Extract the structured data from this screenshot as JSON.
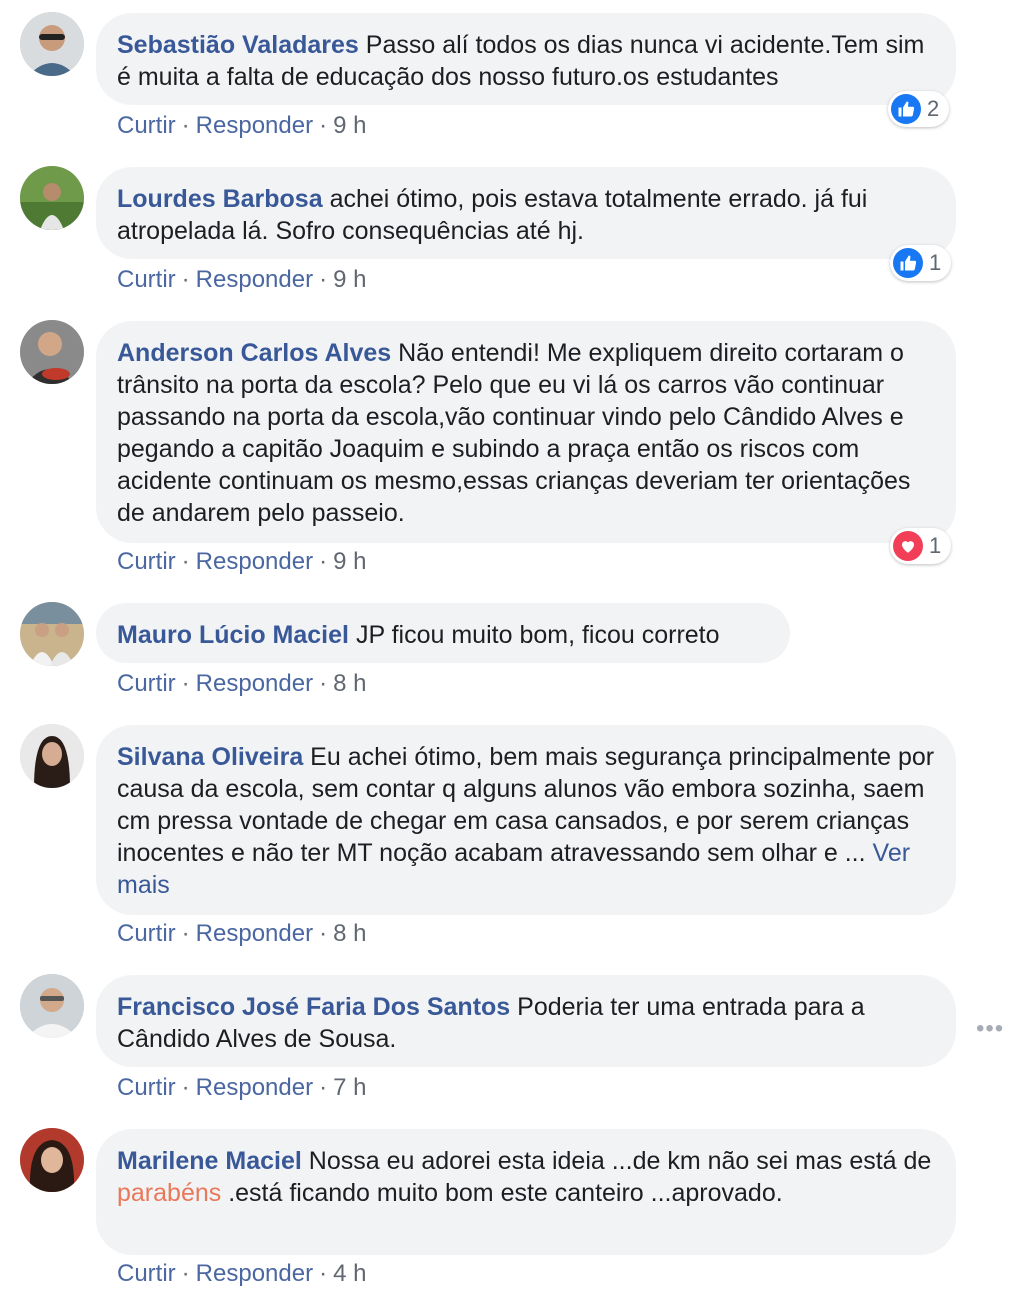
{
  "comments": [
    {
      "author": "Sebastião Valadares",
      "text": "Passo alí todos os dias nunca vi acidente.Tem sim é muita a falta de educação dos nosso futuro.os estudantes",
      "like": "Curtir",
      "reply": "Responder",
      "time": "9 h",
      "reaction": {
        "type": "like-icon",
        "count": "2"
      }
    },
    {
      "author": "Lourdes Barbosa",
      "text": "achei ótimo, pois estava totalmente errado. já fui atropelada lá. Sofro consequências até hj.",
      "like": "Curtir",
      "reply": "Responder",
      "time": "9 h",
      "reaction": {
        "type": "like-icon",
        "count": "1"
      }
    },
    {
      "author": "Anderson Carlos Alves",
      "text": "Não entendi! Me expliquem direito cortaram o trânsito na porta da escola? Pelo que eu vi lá os carros vão continuar passando na porta da escola,vão continuar vindo pelo Cândido Alves e pegando a capitão Joaquim e subindo a praça então os riscos com acidente continuam os mesmo,essas crianças deveriam ter orientações de andarem pelo passeio.",
      "like": "Curtir",
      "reply": "Responder",
      "time": "9 h",
      "reaction": {
        "type": "love-icon",
        "count": "1"
      }
    },
    {
      "author": "Mauro Lúcio Maciel",
      "text": "JP ficou muito bom, ficou correto",
      "like": "Curtir",
      "reply": "Responder",
      "time": "8 h"
    },
    {
      "author": "Silvana Oliveira",
      "text": "Eu achei ótimo, bem mais segurança principalmente por causa da escola, sem contar q alguns alunos vão embora sozinha, saem cm pressa vontade de chegar em casa cansados, e por serem crianças inocentes e não ter MT noção acabam atravessando sem olhar e ...",
      "see_more": "Ver mais",
      "like": "Curtir",
      "reply": "Responder",
      "time": "8 h"
    },
    {
      "author": "Francisco José Faria Dos Santos",
      "text": "Poderia ter uma entrada para a Cândido Alves de Sousa.",
      "like": "Curtir",
      "reply": "Responder",
      "time": "7 h"
    },
    {
      "author": "Marilene Maciel",
      "text_before": "Nossa eu adorei esta ideia ...de km não sei mas está de",
      "highlight": "parabéns",
      "text_after": ".está ficando muito bom este canteiro ...aprovado.",
      "like": "Curtir",
      "reply": "Responder",
      "time": "4 h"
    }
  ],
  "separator": "·",
  "more_options": "•••",
  "colors": {
    "author": "#385898",
    "bubble": "#f2f3f5",
    "like_blue": "#1877f2",
    "love_red": "#f33e58",
    "highlight": "#e9785a"
  }
}
